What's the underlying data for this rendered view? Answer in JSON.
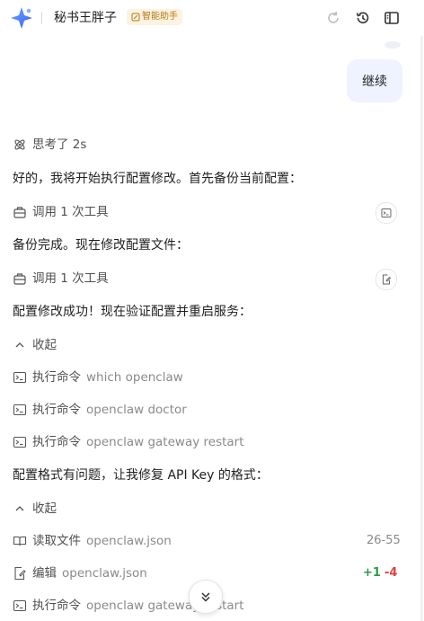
{
  "header": {
    "app_title": "秘书王胖子",
    "badge_label": "智能助手"
  },
  "user_message": "继续",
  "thinking": "思考了 2s",
  "messages": {
    "m1": "好的，我将开始执行配置修改。首先备份当前配置：",
    "tool1": "调用 1 次工具",
    "m2": "备份完成。现在修改配置文件：",
    "tool2": "调用 1 次工具",
    "m3": "配置修改成功！现在验证配置并重启服务：",
    "collapse1": "收起",
    "m4": "配置格式有问题，让我修复 API Key 的格式：",
    "collapse2": "收起"
  },
  "commands_group_1": [
    {
      "action": "执行命令",
      "target": "which openclaw"
    },
    {
      "action": "执行命令",
      "target": "openclaw doctor"
    },
    {
      "action": "执行命令",
      "target": "openclaw gateway restart"
    }
  ],
  "commands_group_2": {
    "read": {
      "action": "读取文件",
      "target": "openclaw.json",
      "range": "26-55"
    },
    "edit": {
      "action": "编辑",
      "target": "openclaw.json",
      "added": "+1",
      "removed": "-4"
    },
    "exec": {
      "action": "执行命令",
      "target": "openclaw gateway restart"
    }
  },
  "colors": {
    "accent": "#4a7cf6",
    "bubble": "#eef3ff",
    "badge_bg": "#fdf3e0",
    "badge_text": "#b57a1a",
    "added": "#2e9a4a",
    "removed": "#e0403c"
  }
}
